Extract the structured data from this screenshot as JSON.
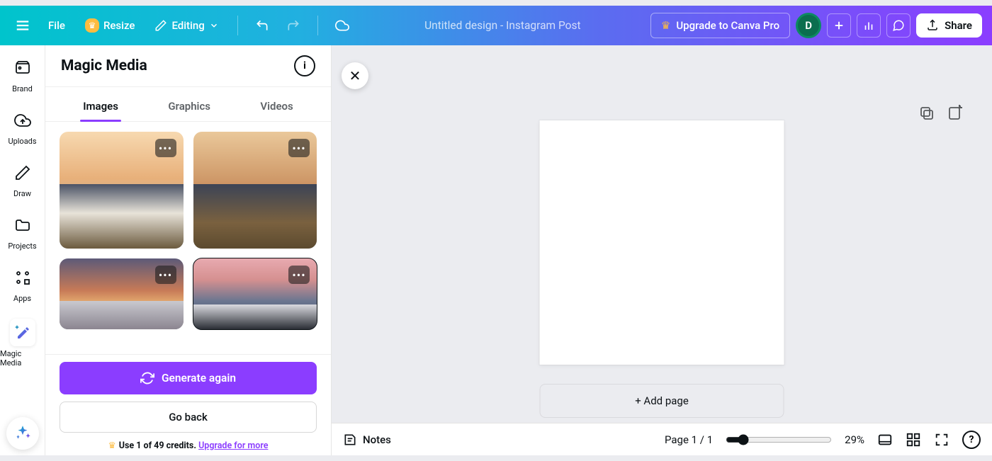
{
  "header": {
    "file": "File",
    "resize": "Resize",
    "editing": "Editing",
    "doc_title": "Untitled design - Instagram Post",
    "upgrade": "Upgrade to Canva Pro",
    "avatar_initial": "D",
    "share": "Share"
  },
  "rail": {
    "brand": "Brand",
    "uploads": "Uploads",
    "draw": "Draw",
    "projects": "Projects",
    "apps": "Apps",
    "magic_media": "Magic Media"
  },
  "panel": {
    "title": "Magic Media",
    "tabs": {
      "images": "Images",
      "graphics": "Graphics",
      "videos": "Videos"
    },
    "generate_btn": "Generate again",
    "back_btn": "Go back",
    "credits_prefix": "Use 1 of 49 credits. ",
    "credits_link": "Upgrade for more"
  },
  "canvas": {
    "add_page": "+ Add page"
  },
  "bottom": {
    "notes": "Notes",
    "page_indicator": "Page 1 / 1",
    "zoom_pct": "29%",
    "zoom_value": 29
  }
}
